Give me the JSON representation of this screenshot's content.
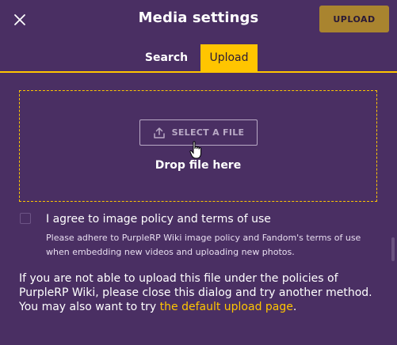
{
  "header": {
    "close_icon": "close-icon",
    "title": "Media settings",
    "upload_button": "UPLOAD"
  },
  "tabs": [
    {
      "label": "Search",
      "active": false
    },
    {
      "label": "Upload",
      "active": true
    }
  ],
  "dropzone": {
    "select_button": "SELECT A FILE",
    "select_icon": "upload-tray-icon",
    "drop_text": "Drop file here"
  },
  "agreement": {
    "checked": false,
    "label": "I agree to image policy and terms of use",
    "note": "Please adhere to PurpleRP Wiki image policy and Fandom's terms of use when embedding new videos and uploading new photos."
  },
  "info": {
    "text": "If you are not able to upload this file under the policies of PurpleRP Wiki, please close this dialog and try another method.",
    "try_prefix": "You may also want to try ",
    "link_text": "the default upload page",
    "suffix": "."
  },
  "colors": {
    "background": "#4a2f63",
    "accent": "#ffc500",
    "upload_button_bg": "#a9842f",
    "muted": "#b9aac6"
  }
}
